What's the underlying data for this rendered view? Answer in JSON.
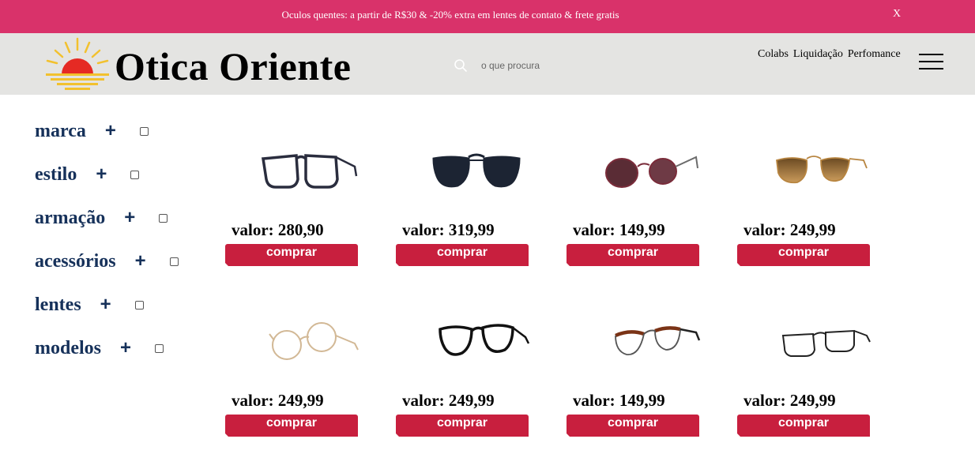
{
  "promo": {
    "text": "Oculos quentes: a partir de R$30 & -20% extra em lentes de contato & frete gratis",
    "close": "X"
  },
  "header": {
    "logo_text": "Otica Oriente",
    "search_placeholder": "o que procura",
    "nav": [
      "Colabs",
      "Liquidação",
      "Perfomance"
    ]
  },
  "filters": [
    {
      "label": "marca",
      "plus": "+"
    },
    {
      "label": "estilo",
      "plus": "+"
    },
    {
      "label": "armação",
      "plus": "+"
    },
    {
      "label": "acessórios",
      "plus": "+"
    },
    {
      "label": "lentes",
      "plus": "+"
    },
    {
      "label": "modelos",
      "plus": "+"
    }
  ],
  "products": [
    {
      "price": "valor: 280,90",
      "button": "comprar",
      "style": "rect-frame",
      "color": "#2a2d3e"
    },
    {
      "price": "valor: 319,99",
      "button": "comprar",
      "style": "aviator-dark",
      "color": "#1c2433"
    },
    {
      "price": "valor: 149,99",
      "button": "comprar",
      "style": "round-brown",
      "color": "#7a2c3a"
    },
    {
      "price": "valor: 249,99",
      "button": "comprar",
      "style": "aviator-gold",
      "color": "#b88540"
    },
    {
      "price": "valor: 249,99",
      "button": "comprar",
      "style": "round-gold",
      "color": "#d2b895"
    },
    {
      "price": "valor: 249,99",
      "button": "comprar",
      "style": "cat-black",
      "color": "#111111"
    },
    {
      "price": "valor: 149,99",
      "button": "comprar",
      "style": "browline-brown",
      "color": "#7a3316"
    },
    {
      "price": "valor: 249,99",
      "button": "comprar",
      "style": "rect-thin",
      "color": "#222222"
    }
  ],
  "colors": {
    "promo_bg": "#d9326a",
    "header_bg": "#e4e4e2",
    "filter_text": "#16315a",
    "button_bg": "#c81f3e"
  }
}
